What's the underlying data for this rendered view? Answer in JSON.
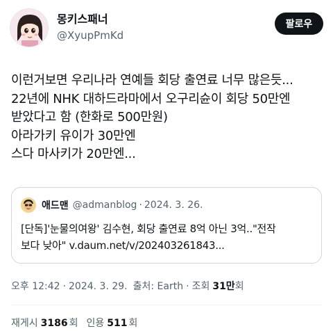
{
  "header": {
    "display_name": "몽키스패너",
    "handle": "@XyupPmKd",
    "follow_label": "팔로우"
  },
  "tweet": {
    "lines": [
      "이런거보면 우리나라 연예들 회당 출연료 너무 많은듯...",
      "22년에 NHK 대하드라마에서 오구리슌이 회당 50만엔",
      "받았다고 함 (한화로 500만원)",
      "아라가키 유이가 30만엔",
      "스다 마사키가 20만엔..."
    ]
  },
  "quote": {
    "name": "애드맨",
    "handle": "@admanblog",
    "separator": "·",
    "date": "2024. 3. 26.",
    "lines": [
      "[단독]'눈물의여왕' 김수현, 회당 출연료 8억 아닌 3억..\"전작",
      "보다 낮아\" v.daum.net/v/202403261843..."
    ]
  },
  "meta": {
    "time": "오후 12:42",
    "separator": "·",
    "date": "2024. 3. 29.",
    "source": "출처: Earth",
    "views_label": "조회",
    "views_count": "31만",
    "views_suffix": "회"
  },
  "stats": {
    "reposts_label": "재게시",
    "reposts_count": "3186",
    "reposts_suffix": "회",
    "quotes_label": "인용",
    "quotes_count": "511",
    "quotes_suffix": "회"
  },
  "icons": {
    "avatar": "cartoon-girl-avatar",
    "quote_avatar": "cartoon-man-avatar"
  },
  "colors": {
    "text": "#0f1419",
    "secondary": "#536471",
    "border": "#cfd9de",
    "button": "#0f1419"
  }
}
